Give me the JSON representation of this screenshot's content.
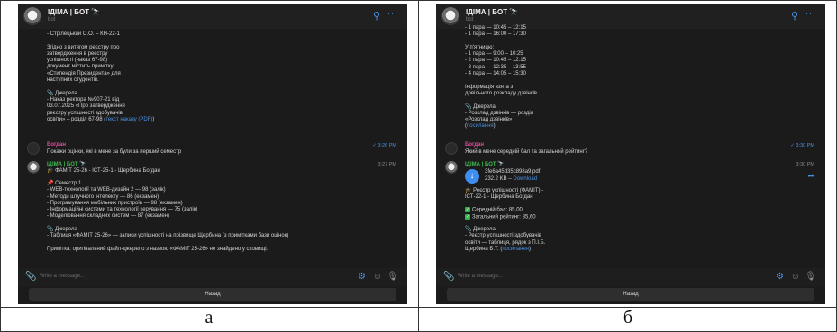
{
  "captions": {
    "left": "а",
    "right": "б"
  },
  "chat": {
    "title": "ІДІМА | БОТ",
    "subtitle": "bot",
    "search_icon": "search-icon",
    "more_icon": "more-icon",
    "input_placeholder": "Write a message...",
    "back_button": "Назад"
  },
  "left": {
    "top_text": "- Стрілецький О.О. – КН-22-1\n\nЗгідно з витягом реєстру про\nзатвердження в реєстру\nуспішності (наказ 67-98)\nдокумент містить примітку\n«Стипендія Президента» для\nнаступних студентів.\n\n📎 Джерела\n- Наказ ректора №907-21 від\n03.07.2025 «Про затвердження\nреєстру успішності здобувачів\nосвіти» – розділ 67-98 (",
    "top_link": "текст наказу (PDF)",
    "top_close": ")",
    "user_name": "Богдан",
    "user_text": "Покажи оцінки, які в мене за були за перший семестр",
    "user_time": "3:26 PM",
    "bot_name": "ІДІМА | БОТ",
    "bot_time": "3:27 PM",
    "bot_head": "🎓 ФАМІТ 25-26 - ІСТ-25-1 - Щербина Богдан",
    "bot_body": "📌 Семестр 1\n- WEB-технології та WEB-дизайн 2 — 98 (залік)\n- Методи штучного інтелекту — 86 (екзамен)\n- Програмування мобільних пристроїв — 98 (екзамен)\n- Інформаційні системи та технології керування — 75 (залік)\n- Моделювання складних систем — 87 (екзамен)\n\n📎 Джерела\n- Таблиця «ФАМІТ 25-26» — записи успішності на прізвище Щербина (з примітками бази оцінок)\n\nПримітка: оригінальний файл-джерело з назвою «ФАМІТ 25-26» не знайдено у сховищі."
  },
  "right": {
    "top_text": "- 1 пара — 10:45 – 12:15\n- 1 пара — 16:00 – 17:30\n\nУ п'ятницю:\n- 1 пара — 9:00 – 10:25\n- 2 пара — 10:45 – 12:15\n- 3 пара — 12:35 – 13:55\n- 4 пара — 14:05 – 15:30\n\nІнформація взята з\nдовільного розкладу дзвінків.\n\n📎 Джерела\n- Розклад дзвінків — розділ\n«Розклад дзвінків»\n(",
    "top_link": "посилання",
    "top_close": ")",
    "user_name": "Богдан",
    "user_text": "Який в мене середній бал та загальний рейтинг?",
    "user_time": "3:30 PM",
    "bot_name": "ІДІМА | БОТ",
    "bot_time": "3:30 PM",
    "file_name": "3fe6a45d35c898a9.pdf",
    "file_size": "232.2 KB –",
    "file_link": "Download",
    "bot_head": "🎓 Реєстр успішності (ФАМІТ) -\nІСТ-22-1 - Щербина Богдан",
    "avg_label": "Середній бал: 85,00",
    "rating_label": "Загальний рейтинг: 85,60",
    "sources_text": "📎 Джерела\n- Реєстр успішності здобувачів\nосвіти — таблиця, рядок з П.І.Б.\nЩербина Б.Т. (",
    "sources_link": "посилання",
    "sources_close": ")"
  },
  "colors": {
    "accent": "#4a90e2",
    "bot_name": "#3fb950",
    "user_name": "#d94f9a",
    "background": "#1b1b1b"
  }
}
